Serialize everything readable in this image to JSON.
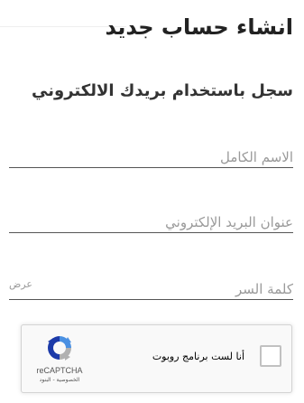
{
  "header": {
    "title": "انشاء حساب جديد"
  },
  "form": {
    "subtitle": "سجل باستخدام بريدك الالكتروني",
    "full_name": {
      "placeholder": "الاسم الكامل",
      "value": ""
    },
    "email": {
      "placeholder": "عنوان البريد الإلكتروني",
      "value": ""
    },
    "password": {
      "placeholder": "كلمة السر",
      "value": "",
      "show_label": "عرض"
    }
  },
  "recaptcha": {
    "label": "أنا لست برنامج روبوت",
    "brand": "reCAPTCHA",
    "links": "الخصوصية - البنود",
    "checked": false,
    "logo_icon": "recaptcha-logo",
    "colors": {
      "blue": "#1c3aa9",
      "light_blue": "#4a90e2",
      "gray": "#b1b1b1"
    }
  }
}
